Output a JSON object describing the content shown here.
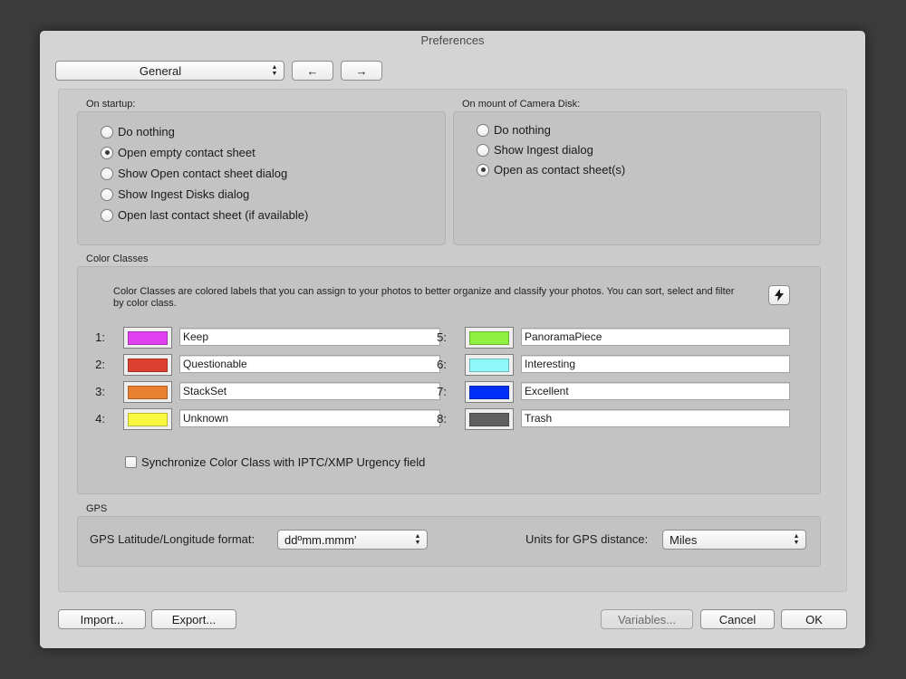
{
  "window": {
    "title": "Preferences"
  },
  "toolbar": {
    "section_value": "General",
    "back_glyph": "←",
    "forward_glyph": "→"
  },
  "startup": {
    "label": "On startup:",
    "options": [
      {
        "label": "Do nothing",
        "selected": false
      },
      {
        "label": "Open empty contact sheet",
        "selected": true
      },
      {
        "label": "Show Open contact sheet dialog",
        "selected": false
      },
      {
        "label": "Show Ingest Disks dialog",
        "selected": false
      },
      {
        "label": "Open last contact sheet (if available)",
        "selected": false
      }
    ]
  },
  "mount": {
    "label": "On mount of Camera Disk:",
    "options": [
      {
        "label": "Do nothing",
        "selected": false
      },
      {
        "label": "Show Ingest dialog",
        "selected": false
      },
      {
        "label": "Open as contact sheet(s)",
        "selected": true
      }
    ]
  },
  "color_classes": {
    "label": "Color Classes",
    "description": "Color Classes are colored labels that you can assign to your photos to better organize and classify your photos.  You can sort, select and filter by color class.",
    "action_icon": "lightning-bolt-icon",
    "items": [
      {
        "number": "1:",
        "name": "Keep",
        "color": "#e040f0"
      },
      {
        "number": "2:",
        "name": "Questionable",
        "color": "#dc4030"
      },
      {
        "number": "3:",
        "name": "StackSet",
        "color": "#e88030"
      },
      {
        "number": "4:",
        "name": "Unknown",
        "color": "#f8f840"
      },
      {
        "number": "5:",
        "name": "PanoramaPiece",
        "color": "#90f040"
      },
      {
        "number": "6:",
        "name": "Interesting",
        "color": "#90f8f8"
      },
      {
        "number": "7:",
        "name": "Excellent",
        "color": "#0030f8"
      },
      {
        "number": "8:",
        "name": "Trash",
        "color": "#606060"
      }
    ],
    "sync_label": "Synchronize Color Class with IPTC/XMP Urgency field",
    "sync_checked": false
  },
  "gps": {
    "label": "GPS",
    "format_label": "GPS Latitude/Longitude format:",
    "format_value": "ddºmm.mmm'",
    "units_label": "Units for GPS distance:",
    "units_value": "Miles"
  },
  "footer": {
    "import_label": "Import...",
    "export_label": "Export...",
    "variables_label": "Variables...",
    "cancel_label": "Cancel",
    "ok_label": "OK"
  }
}
